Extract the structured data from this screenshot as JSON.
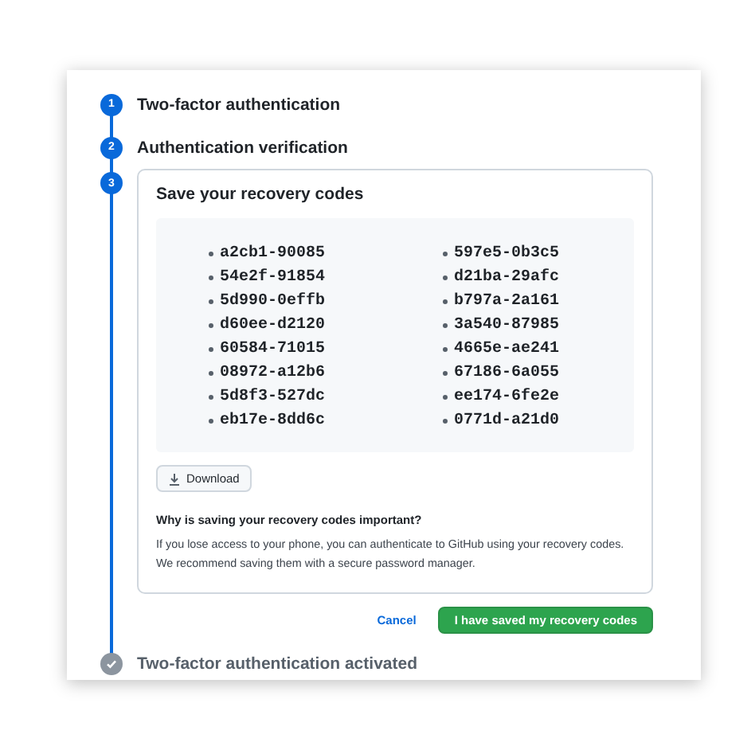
{
  "steps": [
    {
      "kind": "number",
      "number": "1",
      "title": "Two-factor authentication"
    },
    {
      "kind": "number",
      "number": "2",
      "title": "Authentication verification"
    },
    {
      "kind": "number",
      "number": "3",
      "expanded": true
    },
    {
      "kind": "check",
      "title": "Two-factor authentication activated"
    }
  ],
  "recovery_card": {
    "title": "Save your recovery codes",
    "codes": [
      "a2cb1-90085",
      "54e2f-91854",
      "5d990-0effb",
      "d60ee-d2120",
      "60584-71015",
      "08972-a12b6",
      "5d8f3-527dc",
      "eb17e-8dd6c",
      "597e5-0b3c5",
      "d21ba-29afc",
      "b797a-2a161",
      "3a540-87985",
      "4665e-ae241",
      "67186-6a055",
      "ee174-6fe2e",
      "0771d-a21d0"
    ],
    "download_button": "Download",
    "question": "Why is saving your recovery codes important?",
    "explanation": "If you lose access to your phone, you can authenticate to GitHub using your recovery codes. We recommend saving them with a secure password manager."
  },
  "actions": {
    "cancel": "Cancel",
    "confirm": "I have saved my recovery codes"
  }
}
